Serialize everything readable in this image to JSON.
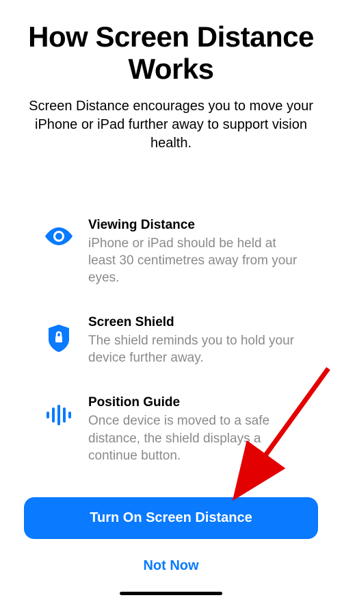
{
  "title": "How Screen Distance Works",
  "subtitle": "Screen Distance encourages you to move your iPhone or iPad further away to support vision health.",
  "features": [
    {
      "title": "Viewing Distance",
      "desc": "iPhone or iPad should be held at least 30 centimetres away from your eyes."
    },
    {
      "title": "Screen Shield",
      "desc": "The shield reminds you to hold your device further away."
    },
    {
      "title": "Position Guide",
      "desc": "Once device is moved to a safe distance, the shield displays a continue button."
    }
  ],
  "buttons": {
    "primary": "Turn On Screen Distance",
    "secondary": "Not Now"
  },
  "colors": {
    "accent": "#0a7aff",
    "text_secondary": "#8a8a8e"
  }
}
